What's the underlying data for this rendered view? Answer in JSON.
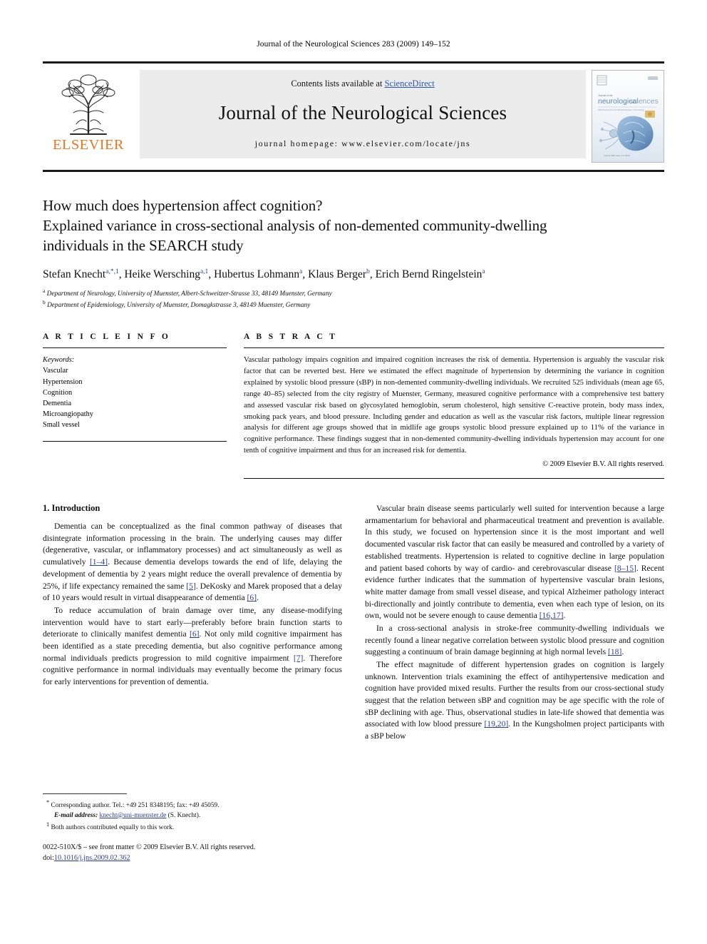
{
  "running_head": "Journal of the Neurological Sciences 283 (2009) 149–152",
  "masthead": {
    "contents_prefix": "Contents lists available at ",
    "sciencedirect": "ScienceDirect",
    "journal_title": "Journal of the Neurological Sciences",
    "homepage": "journal homepage: www.elsevier.com/locate/jns",
    "publisher": "ELSEVIER",
    "cover_title": "neurological sciences"
  },
  "article": {
    "title_line1": "How much does hypertension affect cognition?",
    "title_line2": "Explained variance in cross-sectional analysis of non-demented community-dwelling",
    "title_line3": "individuals in the SEARCH study",
    "authors": [
      {
        "name": "Stefan Knecht",
        "sup": "a,*,1"
      },
      {
        "name": "Heike Wersching",
        "sup": "a,1"
      },
      {
        "name": "Hubertus Lohmann",
        "sup": "a"
      },
      {
        "name": "Klaus Berger",
        "sup": "b"
      },
      {
        "name": "Erich Bernd Ringelstein",
        "sup": "a"
      }
    ],
    "affiliations": [
      {
        "mark": "a",
        "text": "Department of Neurology, University of Muenster, Albert-Schweitzer-Strasse 33, 48149 Muenster, Germany"
      },
      {
        "mark": "b",
        "text": "Department of Epidemiology, University of Muenster, Domagkstrasse 3, 48149 Muenster, Germany"
      }
    ]
  },
  "article_info": {
    "heading": "A R T I C L E   I N F O",
    "keywords_label": "Keywords:",
    "keywords": [
      "Vascular",
      "Hypertension",
      "Cognition",
      "Dementia",
      "Microangiopathy",
      "Small vessel"
    ]
  },
  "abstract": {
    "heading": "A B S T R A C T",
    "text": "Vascular pathology impairs cognition and impaired cognition increases the risk of dementia. Hypertension is arguably the vascular risk factor that can be reverted best. Here we estimated the effect magnitude of hypertension by determining the variance in cognition explained by systolic blood pressure (sBP) in non-demented community-dwelling individuals. We recruited 525 individuals (mean age 65, range 40–85) selected from the city registry of Muenster, Germany, measured cognitive performance with a comprehensive test battery and assessed vascular risk based on glycosylated hemoglobin, serum cholesterol, high sensitive C-reactive protein, body mass index, smoking pack years, and blood pressure. Including gender and education as well as the vascular risk factors, multiple linear regression analysis for different age groups showed that in midlife age groups systolic blood pressure explained up to 11% of the variance in cognitive performance. These findings suggest that in non-demented community-dwelling individuals hypertension may account for one tenth of cognitive impairment and thus for an increased risk for dementia.",
    "copyright": "© 2009 Elsevier B.V. All rights reserved."
  },
  "body": {
    "section_heading": "1. Introduction",
    "left_paragraphs": [
      {
        "parts": [
          {
            "t": "Dementia can be conceptualized as the final common pathway of diseases that disintegrate information processing in the brain. The underlying causes may differ (degenerative, vascular, or inflammatory processes) and act simultaneously as well as cumulatively "
          },
          {
            "t": "[1–4]",
            "ref": true
          },
          {
            "t": ". Because dementia develops towards the end of life, delaying the development of dementia by 2 years might reduce the overall prevalence of dementia by 25%, if life expectancy remained the same "
          },
          {
            "t": "[5]",
            "ref": true
          },
          {
            "t": ". DeKosky and Marek proposed that a delay of 10 years would result in virtual disappearance of dementia "
          },
          {
            "t": "[6]",
            "ref": true
          },
          {
            "t": "."
          }
        ]
      },
      {
        "parts": [
          {
            "t": "To reduce accumulation of brain damage over time, any disease-modifying intervention would have to start early—preferably before brain function starts to deteriorate to clinically manifest dementia "
          },
          {
            "t": "[6]",
            "ref": true
          },
          {
            "t": ". Not only mild cognitive impairment has been identified as a state preceding dementia, but also cognitive performance among normal individuals predicts progression to mild cognitive impairment "
          },
          {
            "t": "[7]",
            "ref": true
          },
          {
            "t": ". Therefore cognitive performance in normal individuals may eventually become the primary focus for early interventions for prevention of dementia."
          }
        ]
      }
    ],
    "right_paragraphs": [
      {
        "parts": [
          {
            "t": "Vascular brain disease seems particularly well suited for intervention because a large armamentarium for behavioral and pharmaceutical treatment and prevention is available. In this study, we focused on hypertension since it is the most important and well documented vascular risk factor that can easily be measured and controlled by a variety of established treatments. Hypertension is related to cognitive decline in large population and patient based cohorts by way of cardio- and cerebrovascular disease "
          },
          {
            "t": "[8–15]",
            "ref": true
          },
          {
            "t": ". Recent evidence further indicates that the summation of hypertensive vascular brain lesions, white matter damage from small vessel disease, and typical Alzheimer pathology interact bi-directionally and jointly contribute to dementia, even when each type of lesion, on its own, would not be severe enough to cause dementia "
          },
          {
            "t": "[16,17]",
            "ref": true
          },
          {
            "t": "."
          }
        ]
      },
      {
        "parts": [
          {
            "t": "In a cross-sectional analysis in stroke-free community-dwelling individuals we recently found a linear negative correlation between systolic blood pressure and cognition suggesting a continuum of brain damage beginning at high normal levels "
          },
          {
            "t": "[18]",
            "ref": true
          },
          {
            "t": "."
          }
        ]
      },
      {
        "parts": [
          {
            "t": "The effect magnitude of different hypertension grades on cognition is largely unknown. Intervention trials examining the effect of antihypertensive medication and cognition have provided mixed results. Further the results from our cross-sectional study suggest that the relation between sBP and cognition may be age specific with the role of sBP declining with age. Thus, observational studies in late-life showed that dementia was associated with low blood pressure "
          },
          {
            "t": "[19,20]",
            "ref": true
          },
          {
            "t": ". In the Kungsholmen project participants with a sBP below"
          }
        ]
      }
    ]
  },
  "footnotes": {
    "corresponding_mark": "*",
    "corresponding_text": "Corresponding author. Tel.: +49 251 8348195; fax: +49 45059.",
    "email_label": "E-mail address:",
    "email": "knecht@uni-muenster.de",
    "email_suffix": "(S. Knecht).",
    "equal_mark": "1",
    "equal_text": "Both authors contributed equally to this work.",
    "imprint": "0022-510X/$ – see front matter © 2009 Elsevier B.V. All rights reserved.",
    "doi_label": "doi:",
    "doi": "10.1016/j.jns.2009.02.362"
  },
  "colors": {
    "link_blue": "#2b57b5",
    "ref_blue": "#2b3f9e",
    "elsevier_orange": "#E87722",
    "box_gray": "#ececec"
  }
}
